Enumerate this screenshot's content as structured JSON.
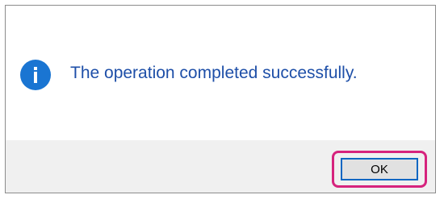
{
  "dialog": {
    "icon": "information-icon",
    "message": "The operation completed successfully.",
    "ok_label": "OK"
  },
  "colors": {
    "icon_blue": "#1a75d2",
    "message_text": "#1e4fa8",
    "footer_background": "#f0f0f0",
    "button_focus_border": "#0a66c2",
    "highlight_annotation": "#d6237d"
  }
}
